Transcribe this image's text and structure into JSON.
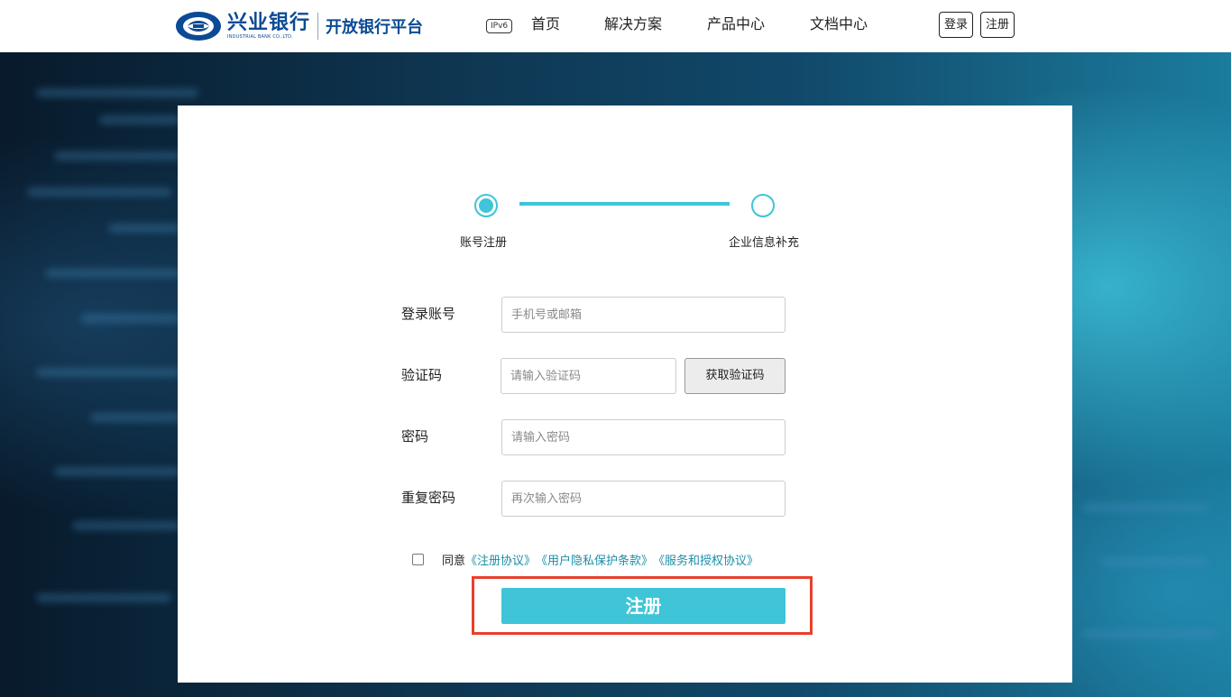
{
  "header": {
    "logo_cn": "兴业银行",
    "logo_en": "INDUSTRIAL BANK CO.,LTD.",
    "platform": "开放银行平台",
    "ipv6_badge": "IPv6",
    "nav": [
      "首页",
      "解决方案",
      "产品中心",
      "文档中心"
    ],
    "login_label": "登录",
    "register_label": "注册"
  },
  "steps": {
    "step1": "账号注册",
    "step2": "企业信息补充",
    "current": 1
  },
  "form": {
    "account_label": "登录账号",
    "account_placeholder": "手机号或邮箱",
    "code_label": "验证码",
    "code_placeholder": "请输入验证码",
    "code_button": "获取验证码",
    "password_label": "密码",
    "password_placeholder": "请输入密码",
    "repeat_label": "重复密码",
    "repeat_placeholder": "再次输入密码",
    "agree_prefix": "同意",
    "link1": "《注册协议》",
    "link2": "《用户隐私保护条款》",
    "link3": "《服务和授权协议》",
    "submit_label": "注册"
  },
  "colors": {
    "accent": "#3fc4d8",
    "brand": "#0b4a95",
    "highlight": "#e8402c",
    "link": "#1b8ea8"
  }
}
